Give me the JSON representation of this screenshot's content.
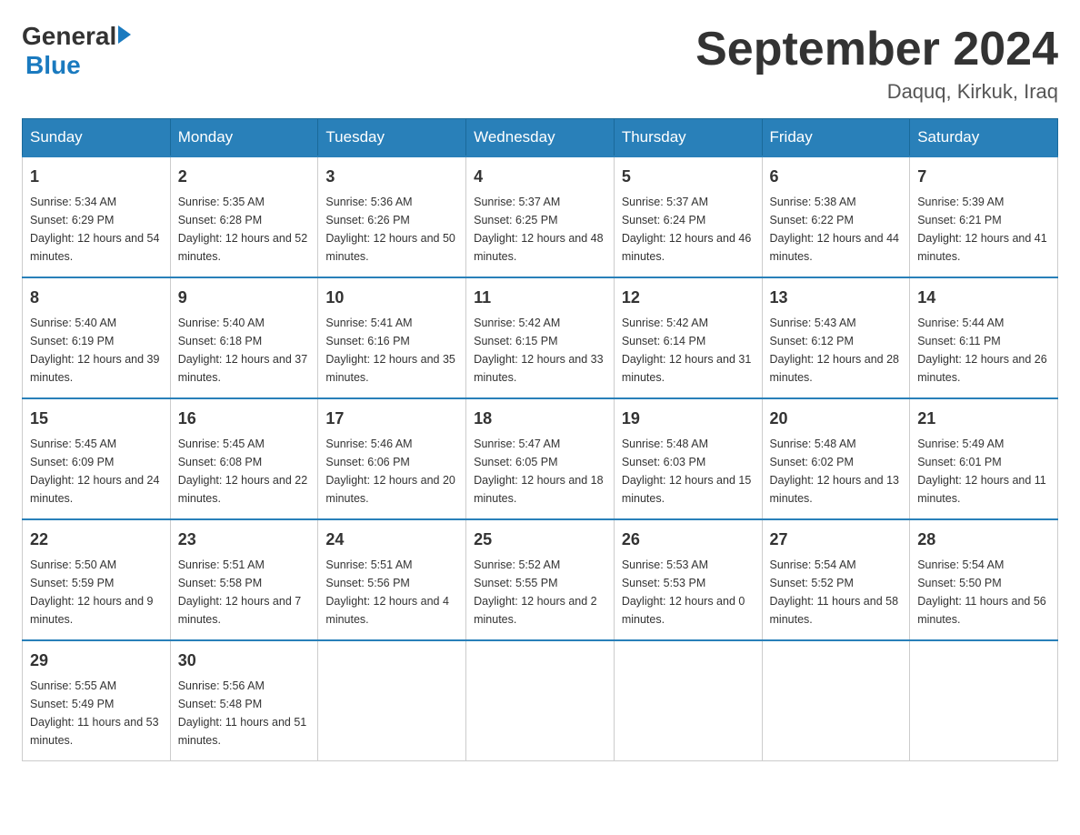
{
  "header": {
    "logo_general": "General",
    "logo_blue": "Blue",
    "title": "September 2024",
    "subtitle": "Daquq, Kirkuk, Iraq"
  },
  "days_of_week": [
    "Sunday",
    "Monday",
    "Tuesday",
    "Wednesday",
    "Thursday",
    "Friday",
    "Saturday"
  ],
  "weeks": [
    [
      {
        "day": "1",
        "sunrise": "5:34 AM",
        "sunset": "6:29 PM",
        "daylight": "12 hours and 54 minutes."
      },
      {
        "day": "2",
        "sunrise": "5:35 AM",
        "sunset": "6:28 PM",
        "daylight": "12 hours and 52 minutes."
      },
      {
        "day": "3",
        "sunrise": "5:36 AM",
        "sunset": "6:26 PM",
        "daylight": "12 hours and 50 minutes."
      },
      {
        "day": "4",
        "sunrise": "5:37 AM",
        "sunset": "6:25 PM",
        "daylight": "12 hours and 48 minutes."
      },
      {
        "day": "5",
        "sunrise": "5:37 AM",
        "sunset": "6:24 PM",
        "daylight": "12 hours and 46 minutes."
      },
      {
        "day": "6",
        "sunrise": "5:38 AM",
        "sunset": "6:22 PM",
        "daylight": "12 hours and 44 minutes."
      },
      {
        "day": "7",
        "sunrise": "5:39 AM",
        "sunset": "6:21 PM",
        "daylight": "12 hours and 41 minutes."
      }
    ],
    [
      {
        "day": "8",
        "sunrise": "5:40 AM",
        "sunset": "6:19 PM",
        "daylight": "12 hours and 39 minutes."
      },
      {
        "day": "9",
        "sunrise": "5:40 AM",
        "sunset": "6:18 PM",
        "daylight": "12 hours and 37 minutes."
      },
      {
        "day": "10",
        "sunrise": "5:41 AM",
        "sunset": "6:16 PM",
        "daylight": "12 hours and 35 minutes."
      },
      {
        "day": "11",
        "sunrise": "5:42 AM",
        "sunset": "6:15 PM",
        "daylight": "12 hours and 33 minutes."
      },
      {
        "day": "12",
        "sunrise": "5:42 AM",
        "sunset": "6:14 PM",
        "daylight": "12 hours and 31 minutes."
      },
      {
        "day": "13",
        "sunrise": "5:43 AM",
        "sunset": "6:12 PM",
        "daylight": "12 hours and 28 minutes."
      },
      {
        "day": "14",
        "sunrise": "5:44 AM",
        "sunset": "6:11 PM",
        "daylight": "12 hours and 26 minutes."
      }
    ],
    [
      {
        "day": "15",
        "sunrise": "5:45 AM",
        "sunset": "6:09 PM",
        "daylight": "12 hours and 24 minutes."
      },
      {
        "day": "16",
        "sunrise": "5:45 AM",
        "sunset": "6:08 PM",
        "daylight": "12 hours and 22 minutes."
      },
      {
        "day": "17",
        "sunrise": "5:46 AM",
        "sunset": "6:06 PM",
        "daylight": "12 hours and 20 minutes."
      },
      {
        "day": "18",
        "sunrise": "5:47 AM",
        "sunset": "6:05 PM",
        "daylight": "12 hours and 18 minutes."
      },
      {
        "day": "19",
        "sunrise": "5:48 AM",
        "sunset": "6:03 PM",
        "daylight": "12 hours and 15 minutes."
      },
      {
        "day": "20",
        "sunrise": "5:48 AM",
        "sunset": "6:02 PM",
        "daylight": "12 hours and 13 minutes."
      },
      {
        "day": "21",
        "sunrise": "5:49 AM",
        "sunset": "6:01 PM",
        "daylight": "12 hours and 11 minutes."
      }
    ],
    [
      {
        "day": "22",
        "sunrise": "5:50 AM",
        "sunset": "5:59 PM",
        "daylight": "12 hours and 9 minutes."
      },
      {
        "day": "23",
        "sunrise": "5:51 AM",
        "sunset": "5:58 PM",
        "daylight": "12 hours and 7 minutes."
      },
      {
        "day": "24",
        "sunrise": "5:51 AM",
        "sunset": "5:56 PM",
        "daylight": "12 hours and 4 minutes."
      },
      {
        "day": "25",
        "sunrise": "5:52 AM",
        "sunset": "5:55 PM",
        "daylight": "12 hours and 2 minutes."
      },
      {
        "day": "26",
        "sunrise": "5:53 AM",
        "sunset": "5:53 PM",
        "daylight": "12 hours and 0 minutes."
      },
      {
        "day": "27",
        "sunrise": "5:54 AM",
        "sunset": "5:52 PM",
        "daylight": "11 hours and 58 minutes."
      },
      {
        "day": "28",
        "sunrise": "5:54 AM",
        "sunset": "5:50 PM",
        "daylight": "11 hours and 56 minutes."
      }
    ],
    [
      {
        "day": "29",
        "sunrise": "5:55 AM",
        "sunset": "5:49 PM",
        "daylight": "11 hours and 53 minutes."
      },
      {
        "day": "30",
        "sunrise": "5:56 AM",
        "sunset": "5:48 PM",
        "daylight": "11 hours and 51 minutes."
      },
      null,
      null,
      null,
      null,
      null
    ]
  ]
}
